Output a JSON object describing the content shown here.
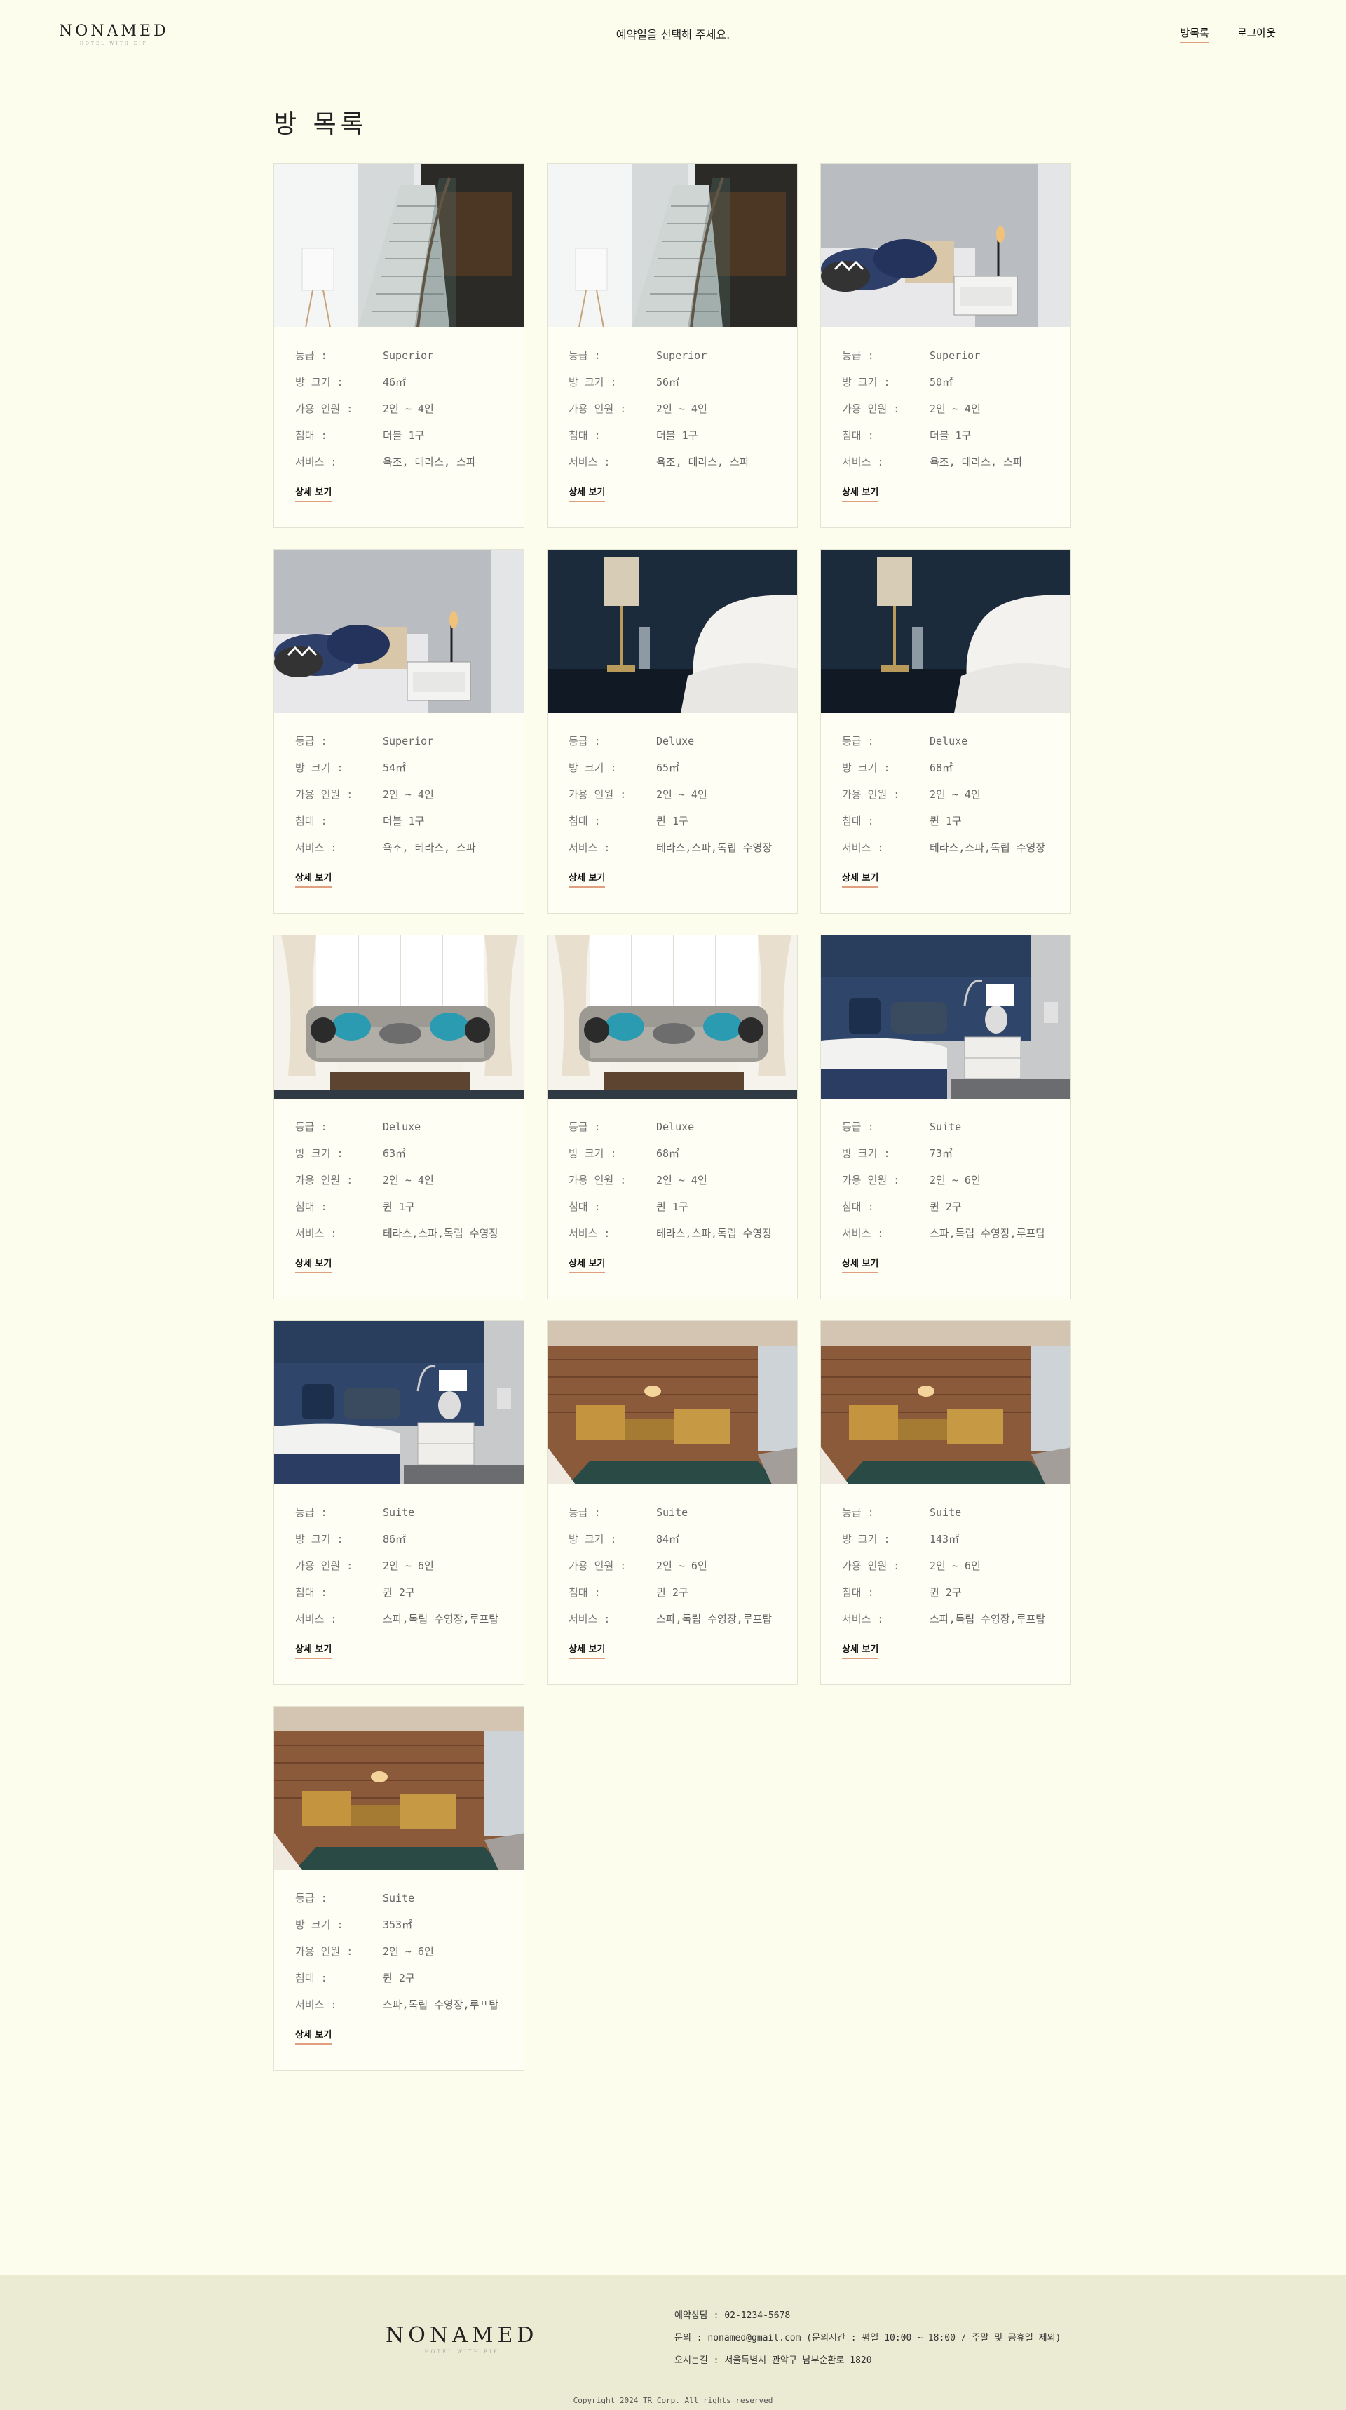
{
  "header": {
    "logo": "NONAMED",
    "logo_sub": "HOTEL WITH EIF",
    "message": "예약일을 선택해 주세요.",
    "nav": [
      {
        "label": "방목록",
        "active": true
      },
      {
        "label": "로그아웃",
        "active": false
      }
    ]
  },
  "page_title": "방 목록",
  "labels": {
    "grade": "등급 :",
    "size": "방 크기 :",
    "capacity": "가용 인원 :",
    "bed": "침대 :",
    "service": "서비스 :",
    "detail": "상세 보기"
  },
  "rooms": [
    {
      "image": "staircase",
      "grade": "Superior",
      "size": "46㎡",
      "capacity": "2인 ~ 4인",
      "bed": "더블 1구",
      "service": "욕조, 테라스, 스파"
    },
    {
      "image": "staircase",
      "grade": "Superior",
      "size": "56㎡",
      "capacity": "2인 ~ 4인",
      "bed": "더블 1구",
      "service": "욕조, 테라스, 스파"
    },
    {
      "image": "bed-lamp",
      "grade": "Superior",
      "size": "50㎡",
      "capacity": "2인 ~ 4인",
      "bed": "더블 1구",
      "service": "욕조, 테라스, 스파"
    },
    {
      "image": "bed-lamp",
      "grade": "Superior",
      "size": "54㎡",
      "capacity": "2인 ~ 4인",
      "bed": "더블 1구",
      "service": "욕조, 테라스, 스파"
    },
    {
      "image": "navy-bed",
      "grade": "Deluxe",
      "size": "65㎡",
      "capacity": "2인 ~ 4인",
      "bed": "퀸 1구",
      "service": "테라스,스파,독립 수영장"
    },
    {
      "image": "navy-bed",
      "grade": "Deluxe",
      "size": "68㎡",
      "capacity": "2인 ~ 4인",
      "bed": "퀸 1구",
      "service": "테라스,스파,독립 수영장"
    },
    {
      "image": "sofa",
      "grade": "Deluxe",
      "size": "63㎡",
      "capacity": "2인 ~ 4인",
      "bed": "퀸 1구",
      "service": "테라스,스파,독립 수영장"
    },
    {
      "image": "sofa",
      "grade": "Deluxe",
      "size": "68㎡",
      "capacity": "2인 ~ 4인",
      "bed": "퀸 1구",
      "service": "테라스,스파,독립 수영장"
    },
    {
      "image": "suite-bed",
      "grade": "Suite",
      "size": "73㎡",
      "capacity": "2인 ~ 6인",
      "bed": "퀸 2구",
      "service": "스파,독립 수영장,루프탑"
    },
    {
      "image": "suite-bed",
      "grade": "Suite",
      "size": "86㎡",
      "capacity": "2인 ~ 6인",
      "bed": "퀸 2구",
      "service": "스파,독립 수영장,루프탑"
    },
    {
      "image": "wood-lounge",
      "grade": "Suite",
      "size": "84㎡",
      "capacity": "2인 ~ 6인",
      "bed": "퀸 2구",
      "service": "스파,독립 수영장,루프탑"
    },
    {
      "image": "wood-lounge",
      "grade": "Suite",
      "size": "143㎡",
      "capacity": "2인 ~ 6인",
      "bed": "퀸 2구",
      "service": "스파,독립 수영장,루프탑"
    },
    {
      "image": "wood-lounge",
      "grade": "Suite",
      "size": "353㎡",
      "capacity": "2인 ~ 6인",
      "bed": "퀸 2구",
      "service": "스파,독립 수영장,루프탑"
    }
  ],
  "footer": {
    "logo": "NONAMED",
    "logo_sub": "HOTEL WITH EIF",
    "phone": "예약상담 : 02-1234-5678",
    "email": "문의 : nonamed@gmail.com (문의시간 : 평일 10:00 ~ 18:00 / 주말 및 공휴일 제외)",
    "address": "오시는길 : 서울특별시 관악구 남부순환로 1820",
    "copyright": "Copyright 2024 TR Corp. All rights reserved"
  }
}
